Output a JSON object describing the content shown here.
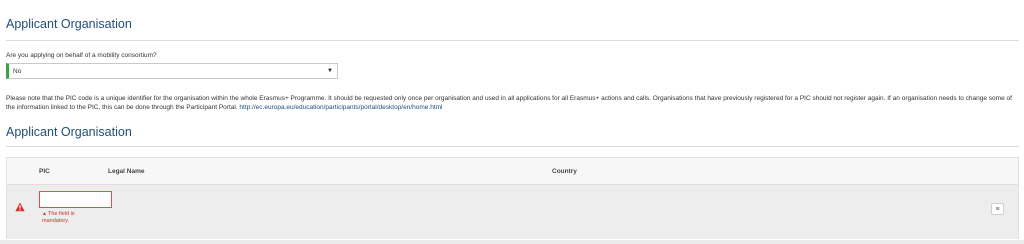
{
  "section1": {
    "title": "Applicant Organisation",
    "question": "Are you applying on behalf of a mobility consortium?",
    "consortium_select": {
      "value": "No"
    }
  },
  "note": {
    "text": "Please note that the PIC code is a unique identifier for the organisation within the whole Erasmus+ Programme. It should be requested only once per organisation and used in all applications for all Erasmus+ actions and calls. Organisations that have previously registered for a PIC should not register again. If an organisation needs to change some of the information linked to the PIC, this can be done through the Participant Portal. ",
    "link": "http://ec.europa.eu/education/participants/portal/desktop/en/home.html"
  },
  "section2": {
    "title": "Applicant Organisation",
    "table": {
      "columns": [
        "PIC",
        "Legal Name",
        "Country"
      ],
      "rows": [
        {
          "pic": "",
          "legal_name": "",
          "country": "",
          "error": "The field is mandatory."
        }
      ]
    }
  },
  "colors": {
    "accent": "#1f4e79",
    "valid": "#3aa345",
    "error": "#d62b2b"
  },
  "icons": {
    "warning": "warning-icon",
    "dropdown": "chevron-down-icon",
    "menu": "menu-icon"
  }
}
